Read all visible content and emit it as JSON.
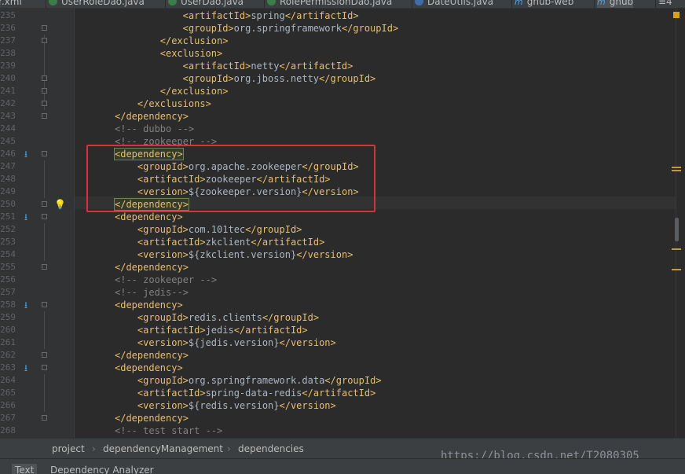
{
  "tabs": [
    {
      "label": "r.xml",
      "icon": "xml-file-icon",
      "active": false
    },
    {
      "label": "UserRoleDao.java",
      "icon": "class-file-icon",
      "active": false
    },
    {
      "label": "UserDao.java",
      "icon": "class-file-icon",
      "active": false
    },
    {
      "label": "RolePermissionDao.java",
      "icon": "class-file-icon",
      "active": false
    },
    {
      "label": "DateUtils.java",
      "icon": "class-file-icon",
      "active": false
    },
    {
      "label": "gnub-web",
      "icon": "maven-module-icon",
      "active": false
    },
    {
      "label": "gnub",
      "icon": "maven-module-icon",
      "active": true
    },
    {
      "label": "≡4",
      "icon": "tab-list-icon",
      "active": false
    }
  ],
  "editor": {
    "lines": [
      {
        "n": "235",
        "indent": 12,
        "text": "<artifactId>spring</artifactId>"
      },
      {
        "n": "236",
        "indent": 12,
        "text": "<groupId>org.springframework</groupId>"
      },
      {
        "n": "237",
        "indent": 8,
        "text": "</exclusion>"
      },
      {
        "n": "238",
        "indent": 8,
        "text": "<exclusion>"
      },
      {
        "n": "239",
        "indent": 12,
        "text": "<artifactId>netty</artifactId>"
      },
      {
        "n": "240",
        "indent": 12,
        "text": "<groupId>org.jboss.netty</groupId>"
      },
      {
        "n": "241",
        "indent": 8,
        "text": "</exclusion>"
      },
      {
        "n": "242",
        "indent": 4,
        "text": "</exclusions>"
      },
      {
        "n": "243",
        "indent": 0,
        "text": "</dependency>"
      },
      {
        "n": "244",
        "indent": 0,
        "text": "<!-- dubbo -->",
        "comment": true
      },
      {
        "n": "245",
        "indent": 0,
        "text": "<!-- zookeeper -->",
        "comment": true
      },
      {
        "n": "246",
        "indent": 0,
        "text": "<dependency>",
        "highlight": true
      },
      {
        "n": "247",
        "indent": 4,
        "text": "<groupId>org.apache.zookeeper</groupId>"
      },
      {
        "n": "248",
        "indent": 4,
        "text": "<artifactId>zookeeper</artifactId>"
      },
      {
        "n": "249",
        "indent": 4,
        "text": "<version>${zookeeper.version}</version>"
      },
      {
        "n": "250",
        "indent": 0,
        "text": "</dependency>",
        "highlight": true
      },
      {
        "n": "251",
        "indent": 0,
        "text": "<dependency>"
      },
      {
        "n": "252",
        "indent": 4,
        "text": "<groupId>com.101tec</groupId>"
      },
      {
        "n": "253",
        "indent": 4,
        "text": "<artifactId>zkclient</artifactId>"
      },
      {
        "n": "254",
        "indent": 4,
        "text": "<version>${zkclient.version}</version>"
      },
      {
        "n": "255",
        "indent": 0,
        "text": "</dependency>"
      },
      {
        "n": "256",
        "indent": 0,
        "text": "<!-- zookeeper -->",
        "comment": true
      },
      {
        "n": "257",
        "indent": 0,
        "text": "<!-- jedis-->",
        "comment": true
      },
      {
        "n": "258",
        "indent": 0,
        "text": "<dependency>"
      },
      {
        "n": "259",
        "indent": 4,
        "text": "<groupId>redis.clients</groupId>"
      },
      {
        "n": "260",
        "indent": 4,
        "text": "<artifactId>jedis</artifactId>"
      },
      {
        "n": "261",
        "indent": 4,
        "text": "<version>${jedis.version}</version>"
      },
      {
        "n": "262",
        "indent": 0,
        "text": "</dependency>"
      },
      {
        "n": "263",
        "indent": 0,
        "text": "<dependency>"
      },
      {
        "n": "264",
        "indent": 4,
        "text": "<groupId>org.springframework.data</groupId>"
      },
      {
        "n": "265",
        "indent": 4,
        "text": "<artifactId>spring-data-redis</artifactId>"
      },
      {
        "n": "266",
        "indent": 4,
        "text": "<version>${redis.version}</version>"
      },
      {
        "n": "267",
        "indent": 0,
        "text": "</dependency>"
      },
      {
        "n": "268",
        "indent": 0,
        "text": "<!-- test start -->",
        "comment": true
      }
    ],
    "bookmark_lines": [
      "246",
      "251",
      "258",
      "263"
    ],
    "fold_lines": [
      "236",
      "237",
      "240",
      "241",
      "242",
      "243",
      "246",
      "250",
      "251",
      "255",
      "258",
      "262",
      "263",
      "267"
    ],
    "bulb_line": "250",
    "current_line": "250",
    "colors": {
      "tag": "#e8bf6a",
      "text": "#a9b7c6",
      "comment": "#808080",
      "annotation_box": "#d9323a"
    }
  },
  "breadcrumbs": [
    "project",
    "dependencyManagement",
    "dependencies"
  ],
  "watermark": "https://blog.csdn.net/T2080305",
  "bottom_tabs": [
    {
      "label": "Text",
      "active": true
    },
    {
      "label": "Dependency Analyzer",
      "active": false
    }
  ]
}
